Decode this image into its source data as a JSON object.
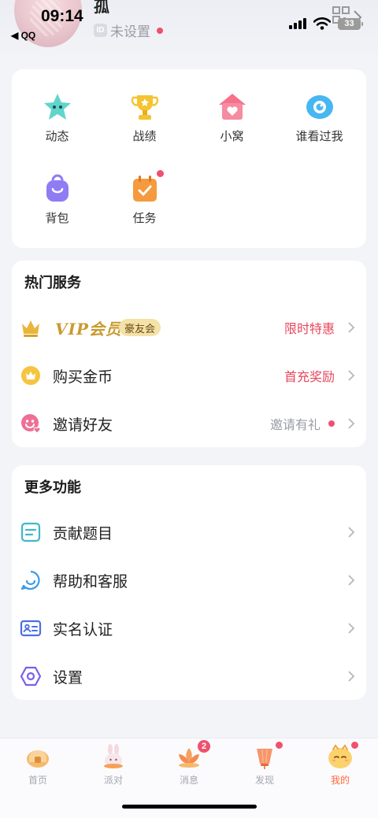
{
  "status_bar": {
    "time": "09:14",
    "back_app": "◀ QQ",
    "battery": "33"
  },
  "profile": {
    "nickname": "孤",
    "id_badge": "ID",
    "id_text": "未设置"
  },
  "grid": [
    {
      "label": "动态",
      "icon": "star-face-icon"
    },
    {
      "label": "战绩",
      "icon": "trophy-icon"
    },
    {
      "label": "小窝",
      "icon": "house-heart-icon"
    },
    {
      "label": "谁看过我",
      "icon": "eye-icon"
    },
    {
      "label": "背包",
      "icon": "backpack-icon"
    },
    {
      "label": "任务",
      "icon": "task-calendar-icon",
      "has_dot": true
    }
  ],
  "hot_services": {
    "title": "热门服务",
    "vip": {
      "word": "VIP会员",
      "badge": "豪友会",
      "right": "限时特惠"
    },
    "coins": {
      "label": "购买金币",
      "right": "首充奖励"
    },
    "invite": {
      "label": "邀请好友",
      "right": "邀请有礼"
    }
  },
  "more": {
    "title": "更多功能",
    "items": [
      {
        "label": "贡献题目",
        "icon": "document-icon"
      },
      {
        "label": "帮助和客服",
        "icon": "chat-bubble-icon"
      },
      {
        "label": "实名认证",
        "icon": "id-card-icon"
      },
      {
        "label": "设置",
        "icon": "hexagon-settings-icon"
      }
    ]
  },
  "tabs": [
    {
      "label": "首页",
      "icon": "home-icon"
    },
    {
      "label": "派对",
      "icon": "bunny-icon"
    },
    {
      "label": "消息",
      "icon": "lotus-icon",
      "badge": "2"
    },
    {
      "label": "发现",
      "icon": "lantern-icon",
      "has_dot": true
    },
    {
      "label": "我的",
      "icon": "mascot-icon",
      "has_dot": true,
      "active": true
    }
  ],
  "colors": {
    "accent": "#e8475b",
    "tab_active": "#ff6a3d",
    "background": "#f3f4f8"
  }
}
